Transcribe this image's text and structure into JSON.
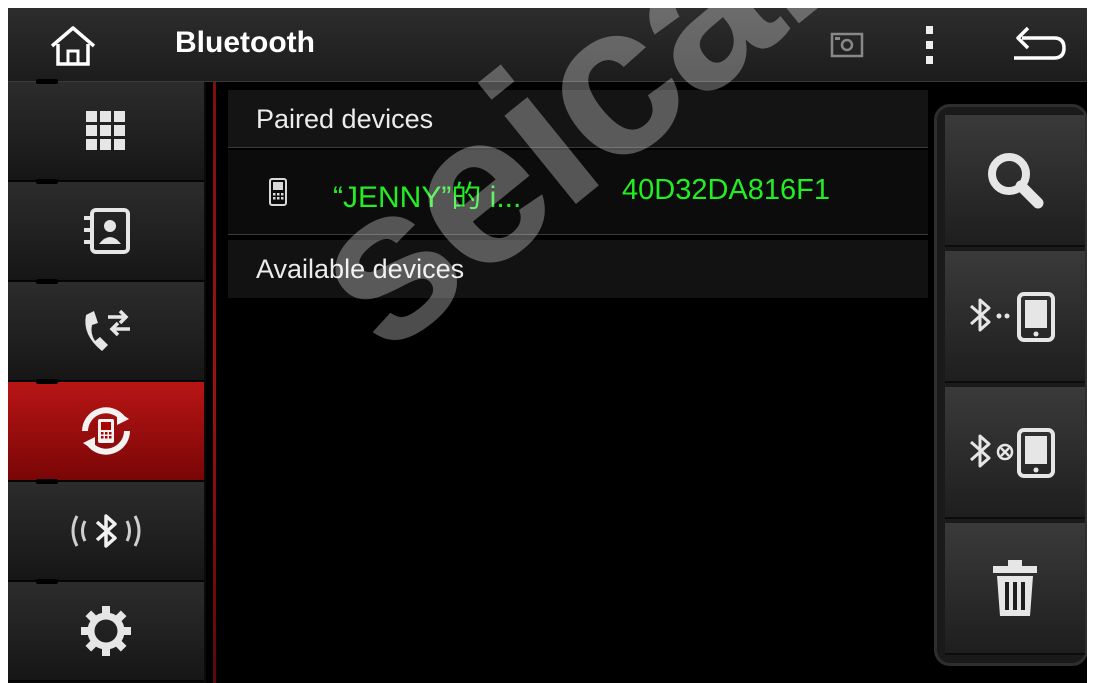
{
  "topbar": {
    "title": "Bluetooth",
    "home_icon": "home-icon",
    "screenshot_icon": "screenshot-icon",
    "menu_icon": "overflow-menu-icon",
    "back_icon": "back-icon"
  },
  "sidebar": {
    "items": [
      {
        "name": "dialpad",
        "icon": "dialpad-icon"
      },
      {
        "name": "contacts",
        "icon": "contacts-icon"
      },
      {
        "name": "call-log",
        "icon": "call-transfer-icon"
      },
      {
        "name": "phone-sync",
        "icon": "phone-sync-icon",
        "active": true
      },
      {
        "name": "bluetooth-music",
        "icon": "bluetooth-audio-icon"
      },
      {
        "name": "settings",
        "icon": "gear-icon"
      }
    ]
  },
  "main": {
    "paired_header": "Paired devices",
    "paired_devices": [
      {
        "name": "“JENNY”的 i...",
        "address": "40D32DA816F1",
        "icon": "phone-icon"
      }
    ],
    "available_header": "Available devices"
  },
  "actions": {
    "items": [
      {
        "name": "search",
        "icon": "search-icon"
      },
      {
        "name": "connect",
        "icon": "bluetooth-connect-icon"
      },
      {
        "name": "disconnect",
        "icon": "bluetooth-disconnect-icon"
      },
      {
        "name": "delete",
        "icon": "trash-icon"
      }
    ]
  },
  "watermark": "seicane",
  "colors": {
    "accent_red": "#b81515",
    "device_text": "#22ee22",
    "background": "#000000"
  }
}
